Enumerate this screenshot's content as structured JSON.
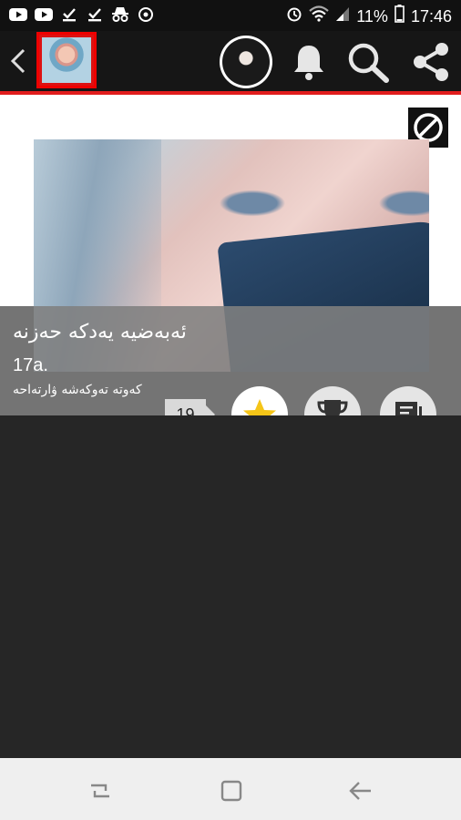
{
  "status_bar": {
    "battery": "11%",
    "time": "17:46",
    "left_icons": [
      "youtube-icon",
      "youtube-icon",
      "download-check-icon",
      "download-check-icon",
      "incognito-icon",
      "sync-icon"
    ],
    "right_icons": [
      "alarm-icon",
      "wifi-icon",
      "signal-icon",
      "battery-icon"
    ]
  },
  "app_bar": {
    "back_icon": "chevron-left-icon",
    "actions": [
      "user-avatar",
      "bell-icon",
      "search-icon",
      "share-icon"
    ]
  },
  "post": {
    "block_icon": "block-icon",
    "title": "ئەبەضیە یەدکە حەزنە",
    "subtitle": "17a.",
    "caption": "کەوتە تەوکەشە ۋارتەاحە",
    "count": "19",
    "action_icons": [
      "star-icon",
      "trophy-icon",
      "chat-icon"
    ],
    "star_color": "#f5c518"
  },
  "nav_bar": {
    "icons": [
      "recents-icon",
      "home-icon",
      "back-arrow-icon"
    ]
  }
}
